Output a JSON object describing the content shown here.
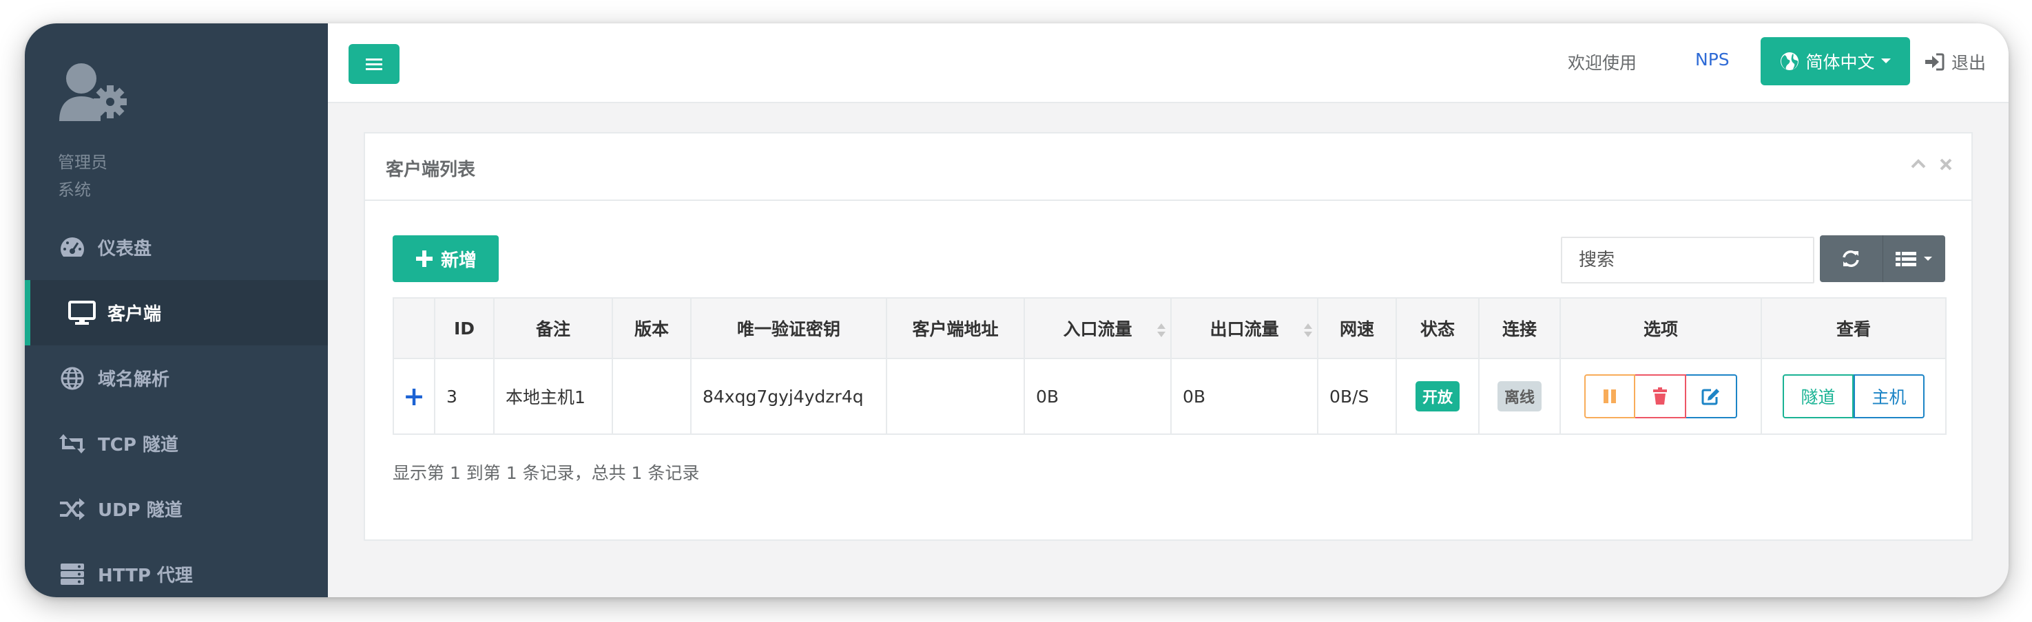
{
  "sidebar": {
    "profile": {
      "name": "管理员",
      "role": "系统"
    },
    "items": [
      {
        "label": "仪表盘",
        "icon": "dashboard-icon"
      },
      {
        "label": "客户端",
        "icon": "monitor-icon",
        "active": true
      },
      {
        "label": "域名解析",
        "icon": "globe-icon"
      },
      {
        "label": "TCP 隧道",
        "icon": "retweet-icon"
      },
      {
        "label": "UDP 隧道",
        "icon": "random-icon"
      },
      {
        "label": "HTTP 代理",
        "icon": "server-icon"
      }
    ]
  },
  "header": {
    "welcome": "欢迎使用",
    "brand": "NPS",
    "language": "简体中文",
    "logout": "退出"
  },
  "panel": {
    "title": "客户端列表",
    "add_label": "新增",
    "search_placeholder": "搜索",
    "columns": [
      "",
      "ID",
      "备注",
      "版本",
      "唯一验证密钥",
      "客户端地址",
      "入口流量",
      "出口流量",
      "网速",
      "状态",
      "连接",
      "选项",
      "查看"
    ],
    "rows": [
      {
        "expand": "+",
        "id": "3",
        "remark": "本地主机1",
        "version": "",
        "vkey": "84xqg7gyj4ydzr4q",
        "address": "",
        "in_flow": "0B",
        "out_flow": "0B",
        "speed": "0B/S",
        "status": "开放",
        "connection": "离线",
        "view_tunnel": "隧道",
        "view_host": "主机"
      }
    ],
    "footer": "显示第 1 到第 1 条记录，总共 1 条记录"
  },
  "colors": {
    "sidebar_bg": "#2f4050",
    "accent": "#1ab394",
    "primary": "#1c84c6",
    "warning": "#f8ac59",
    "danger": "#ed5565",
    "link": "#2f6bd6"
  }
}
